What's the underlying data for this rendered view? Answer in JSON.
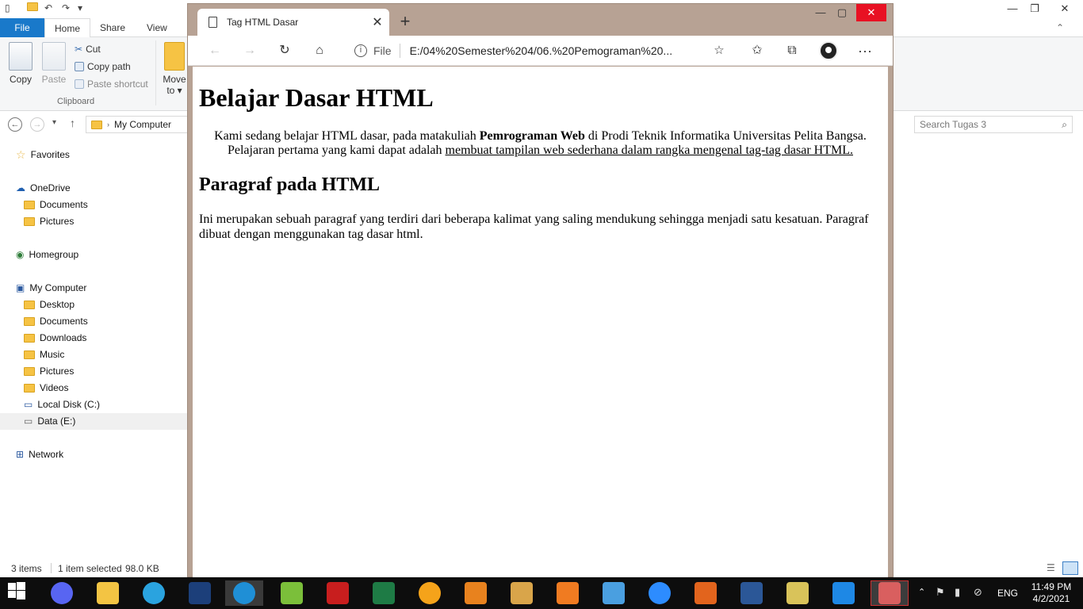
{
  "explorer": {
    "ribbon_tabs": [
      "File",
      "Home",
      "Share",
      "View"
    ],
    "clipboard": {
      "copy": "Copy",
      "paste": "Paste",
      "cut": "Cut",
      "copy_path": "Copy path",
      "paste_shortcut": "Paste shortcut",
      "move_to_line1": "Move",
      "move_to_line2": "to ▾",
      "group_label": "Clipboard"
    },
    "address": "My Computer",
    "search_placeholder": "Search Tugas 3",
    "nav": {
      "favorites": "Favorites",
      "onedrive": "OneDrive",
      "onedrive_children": [
        "Documents",
        "Pictures"
      ],
      "homegroup": "Homegroup",
      "my_computer": "My Computer",
      "my_computer_children": [
        "Desktop",
        "Documents",
        "Downloads",
        "Music",
        "Pictures",
        "Videos",
        "Local Disk (C:)",
        "Data (E:)"
      ],
      "network": "Network"
    },
    "status": {
      "items": "3 items",
      "selected": "1 item selected",
      "size": "98.0 KB"
    }
  },
  "edge": {
    "tab_title": "Tag HTML Dasar",
    "url_scheme": "File",
    "url": "E:/04%20Semester%204/06.%20Pemograman%20...",
    "page": {
      "h1": "Belajar Dasar HTML",
      "p1_text1": "Kami sedang belajar HTML dasar, pada matakuliah ",
      "p1_bold": "Pemrograman Web",
      "p1_text2": " di Prodi Teknik Informatika Universitas Pelita Bangsa. Pelajaran pertama yang kami dapat adalah ",
      "p1_underline": "membuat tampilan web sederhana dalam rangka mengenal tag-tag dasar HTML.",
      "h2": "Paragraf pada HTML",
      "p2": "Ini merupakan sebuah paragraf yang terdiri dari beberapa kalimat yang saling mendukung sehingga menjadi satu kesatuan. Paragraf dibuat dengan menggunakan tag dasar html."
    }
  },
  "taskbar": {
    "language": "ENG",
    "time": "11:49 PM",
    "date": "4/2/2021",
    "apps": [
      {
        "name": "start-button",
        "color": "#ffffff"
      },
      {
        "name": "discord",
        "color": "#5865f2"
      },
      {
        "name": "file-explorer",
        "color": "#f3c443"
      },
      {
        "name": "telegram",
        "color": "#2aa3df"
      },
      {
        "name": "dev-cpp",
        "color": "#1c3f7a"
      },
      {
        "name": "edge",
        "color": "#1f8fd6"
      },
      {
        "name": "notepad-plus",
        "color": "#7bbf3a"
      },
      {
        "name": "acrobat",
        "color": "#c81e1e"
      },
      {
        "name": "excel",
        "color": "#1e7b45"
      },
      {
        "name": "media-player",
        "color": "#f5a31a"
      },
      {
        "name": "sublime-text",
        "color": "#e8821e"
      },
      {
        "name": "paint",
        "color": "#d9a54a"
      },
      {
        "name": "xampp",
        "color": "#f07b21"
      },
      {
        "name": "video-editor",
        "color": "#4a9fe0"
      },
      {
        "name": "zoom",
        "color": "#2d8cff"
      },
      {
        "name": "matlab",
        "color": "#e2641d"
      },
      {
        "name": "word",
        "color": "#2b5797"
      },
      {
        "name": "folder-app",
        "color": "#d9c35a"
      },
      {
        "name": "vscode",
        "color": "#1e88e5"
      },
      {
        "name": "snipping-tool",
        "color": "#d95f5f"
      }
    ]
  }
}
